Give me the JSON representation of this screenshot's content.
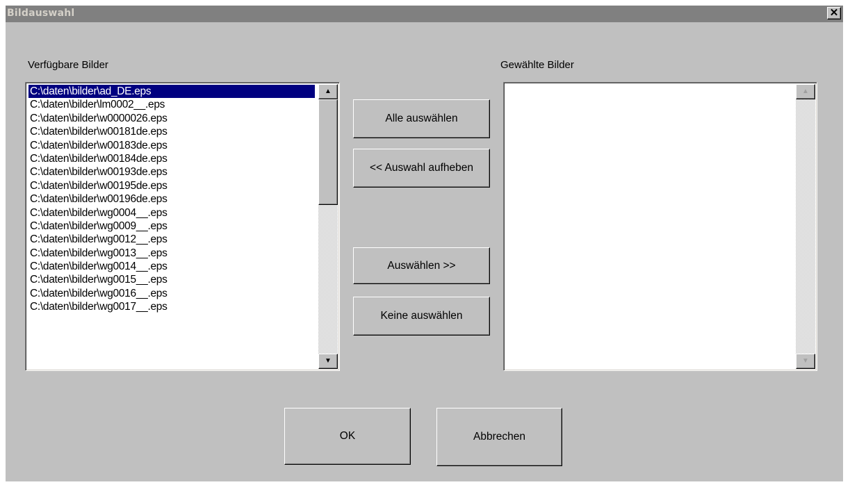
{
  "window": {
    "title": "Bildauswahl",
    "close_glyph": "✕"
  },
  "available": {
    "label": "Verfügbare Bilder",
    "selected_index": 0,
    "items": [
      "C:\\daten\\bilder\\ad_DE.eps",
      "C:\\daten\\bilder\\lm0002__.eps",
      "C:\\daten\\bilder\\w0000026.eps",
      "C:\\daten\\bilder\\w00181de.eps",
      "C:\\daten\\bilder\\w00183de.eps",
      "C:\\daten\\bilder\\w00184de.eps",
      "C:\\daten\\bilder\\w00193de.eps",
      "C:\\daten\\bilder\\w00195de.eps",
      "C:\\daten\\bilder\\w00196de.eps",
      "C:\\daten\\bilder\\wg0004__.eps",
      "C:\\daten\\bilder\\wg0009__.eps",
      "C:\\daten\\bilder\\wg0012__.eps",
      "C:\\daten\\bilder\\wg0013__.eps",
      "C:\\daten\\bilder\\wg0014__.eps",
      "C:\\daten\\bilder\\wg0015__.eps",
      "C:\\daten\\bilder\\wg0016__.eps",
      "C:\\daten\\bilder\\wg0017__.eps"
    ]
  },
  "chosen": {
    "label": "Gewählte Bilder",
    "items": []
  },
  "buttons": {
    "select_all": "Alle auswählen",
    "deselect": "<< Auswahl aufheben",
    "select": "Auswählen >>",
    "select_none": "Keine auswählen",
    "ok": "OK",
    "cancel": "Abbrechen"
  },
  "icons": {
    "scroll_up": "▲",
    "scroll_down": "▼"
  }
}
